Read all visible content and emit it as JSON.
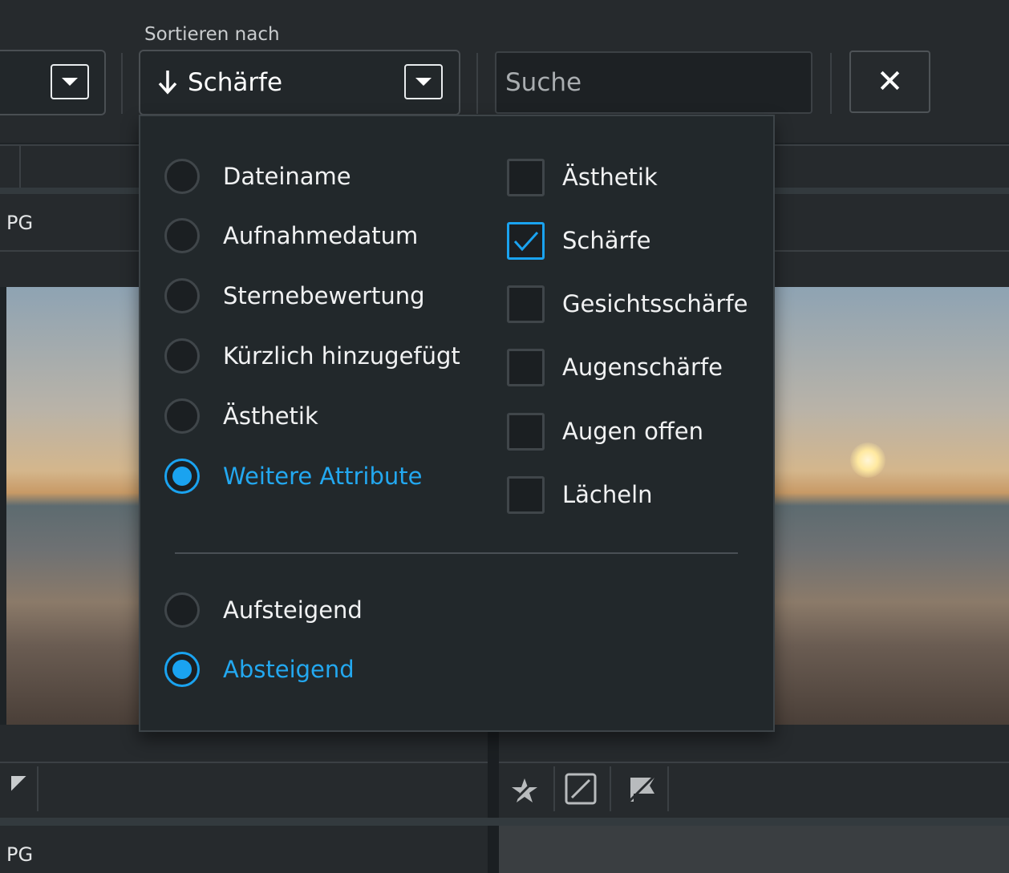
{
  "toolbar": {
    "sort_label": "Sortieren nach",
    "sort_value": "Schärfe",
    "search_placeholder": "Suche"
  },
  "files": {
    "label_top": "PG",
    "label_bottom": "PG"
  },
  "sort_menu": {
    "fields": [
      {
        "label": "Dateiname",
        "selected": false
      },
      {
        "label": "Aufnahmedatum",
        "selected": false
      },
      {
        "label": "Sternebewertung",
        "selected": false
      },
      {
        "label": "Kürzlich hinzugefügt",
        "selected": false
      },
      {
        "label": "Ästhetik",
        "selected": false
      },
      {
        "label": "Weitere Attribute",
        "selected": true
      }
    ],
    "attributes": [
      {
        "label": "Ästhetik",
        "checked": false
      },
      {
        "label": "Schärfe",
        "checked": true
      },
      {
        "label": "Gesichtsschärfe",
        "checked": false
      },
      {
        "label": "Augenschärfe",
        "checked": false
      },
      {
        "label": "Augen offen",
        "checked": false
      },
      {
        "label": "Lächeln",
        "checked": false
      }
    ],
    "order": [
      {
        "label": "Aufsteigend",
        "selected": false
      },
      {
        "label": "Absteigend",
        "selected": true
      }
    ]
  },
  "colors": {
    "accent": "#1aa3f0",
    "panel_bg": "#22282b",
    "toolbar_bg": "#262a2d"
  },
  "icons": [
    "chevron-down-icon",
    "arrow-down-icon",
    "close-icon",
    "unrated-star-icon",
    "color-label-icon",
    "flag-icon"
  ]
}
